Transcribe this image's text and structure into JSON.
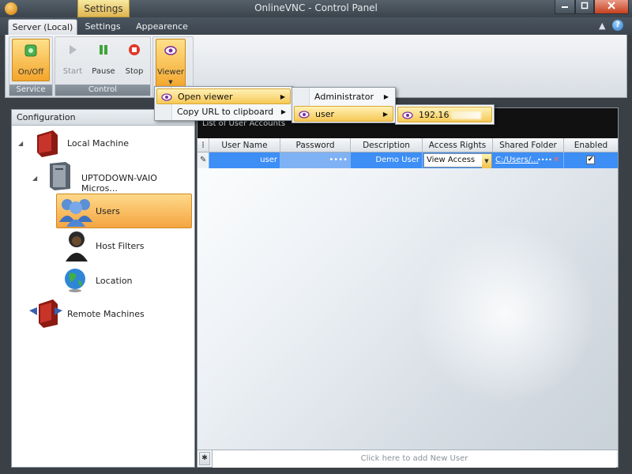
{
  "window": {
    "title": "OnlineVNC - Control Panel",
    "contextual_tab": "Settings"
  },
  "ribbon_tabs": [
    {
      "label": "Server (Local)",
      "active": true
    },
    {
      "label": "Settings",
      "active": false
    },
    {
      "label": "Appearence",
      "active": false
    }
  ],
  "ribbon": {
    "service_group": {
      "label": "Service",
      "on_off": "On/Off"
    },
    "control_group": {
      "label": "Control",
      "start": "Start",
      "pause": "Pause",
      "stop": "Stop"
    },
    "viewer": {
      "label": "Viewer"
    }
  },
  "config_panel": {
    "header": "Configuration",
    "tree": {
      "local_machine": "Local Machine",
      "computer": "UPTODOWN-VAIO Micros...",
      "users": "Users",
      "host_filters": "Host Filters",
      "location": "Location",
      "remote_machines": "Remote Machines"
    }
  },
  "user_accounts": {
    "title": "List of User Accounts",
    "columns": [
      "User Name",
      "Password",
      "Description",
      "Access Rights",
      "Shared Folder",
      "Enabled"
    ],
    "rows": [
      {
        "user_name": "user",
        "password": "••••",
        "description": "Demo User",
        "access_rights": "View Access",
        "shared_folder": "C:/Users/...",
        "shared_folder_extra": "••••",
        "enabled": true
      }
    ],
    "add_new": "Click here to add New User"
  },
  "context_menu": {
    "items": [
      {
        "label": "Open viewer",
        "has_submenu": true
      },
      {
        "label": "Copy URL to clipboard",
        "has_submenu": true
      }
    ],
    "submenu": [
      {
        "label": "Administrator",
        "has_submenu": true
      },
      {
        "label": "user",
        "has_submenu": true
      }
    ],
    "subsubmenu": [
      {
        "label": "192.16"
      }
    ]
  },
  "colors": {
    "accent": "#f4a541",
    "highlight": "#f6c957",
    "selection": "#3d8ef5",
    "titlebar": "#3b444c"
  },
  "icons": {
    "app": "app-orb-icon",
    "on_off": "power-icon",
    "start": "play-icon",
    "pause": "pause-icon",
    "stop": "stop-icon",
    "viewer": "eye-icon",
    "local_machine": "red-computer-icon",
    "computer": "computer-tower-icon",
    "users": "users-group-icon",
    "host_filters": "hooded-person-icon",
    "location": "globe-icon",
    "remote_machines": "red-arrows-computer-icon",
    "help": "help-icon"
  }
}
